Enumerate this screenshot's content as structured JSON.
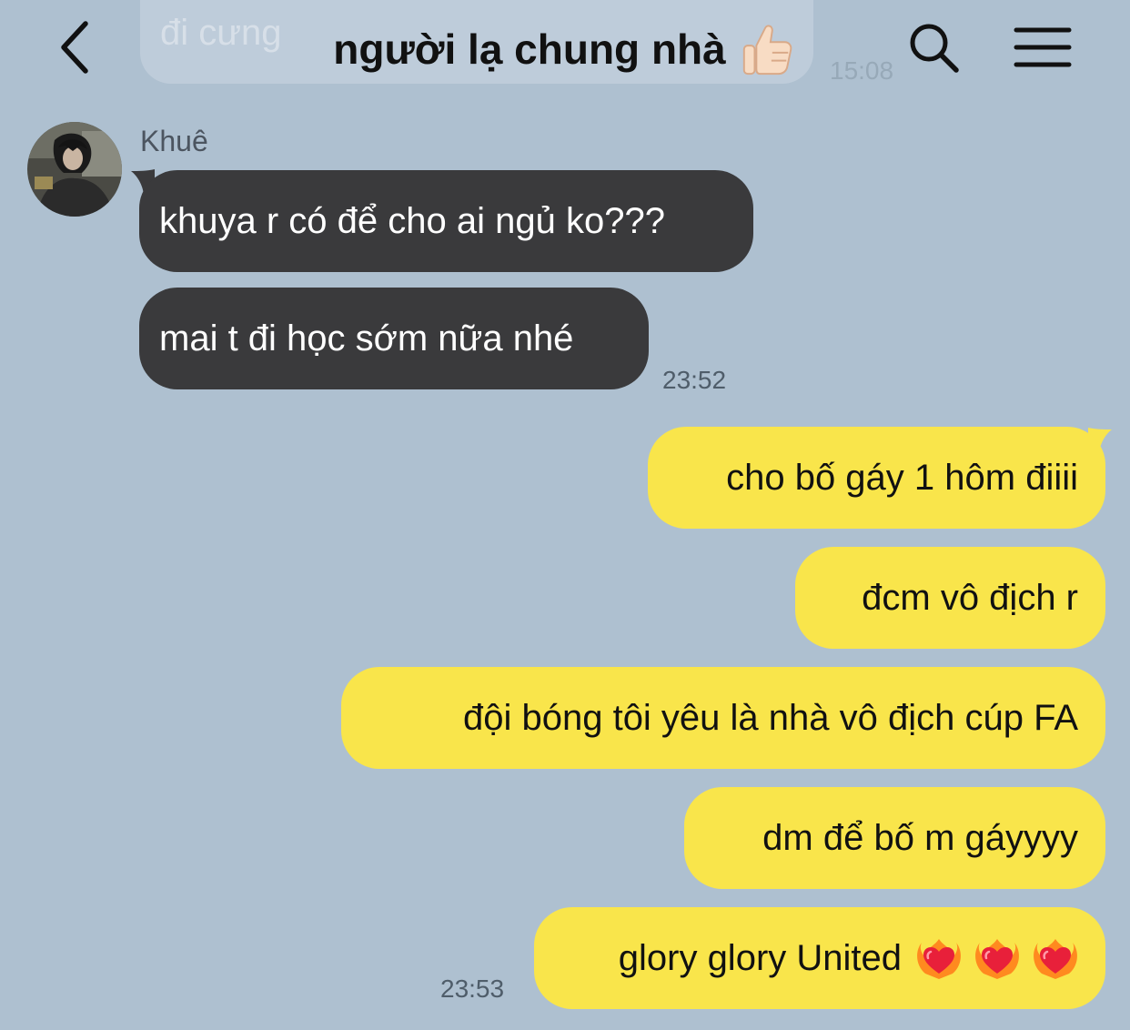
{
  "background_color": "#aec0d0",
  "previous_message": {
    "text": "đi cưng",
    "time": "15:08"
  },
  "header": {
    "back_icon": "chevron-left-icon",
    "title": "người lạ chung nhà",
    "title_emoji": "thumbs-up-icon",
    "search_icon": "search-icon",
    "menu_icon": "hamburger-menu-icon"
  },
  "contact": {
    "name": "Khuê",
    "avatar_icon": "avatar-photo"
  },
  "incoming": {
    "color": "#3a3a3c",
    "messages": [
      {
        "text": "khuya r có để cho ai ngủ ko???"
      },
      {
        "text": "mai t đi học sớm nữa nhé"
      }
    ],
    "time": "23:52"
  },
  "outgoing": {
    "color": "#f9e54b",
    "messages": [
      {
        "text": "cho bố gáy 1 hôm điiii"
      },
      {
        "text": "đcm vô địch r"
      },
      {
        "text": "đội bóng tôi yêu là nhà vô địch cúp FA"
      },
      {
        "text": "dm để bố m gáyyyy"
      },
      {
        "text": "glory glory United",
        "emojis": [
          "heart-on-fire-icon",
          "heart-on-fire-icon",
          "heart-on-fire-icon"
        ]
      }
    ],
    "time": "23:53"
  }
}
